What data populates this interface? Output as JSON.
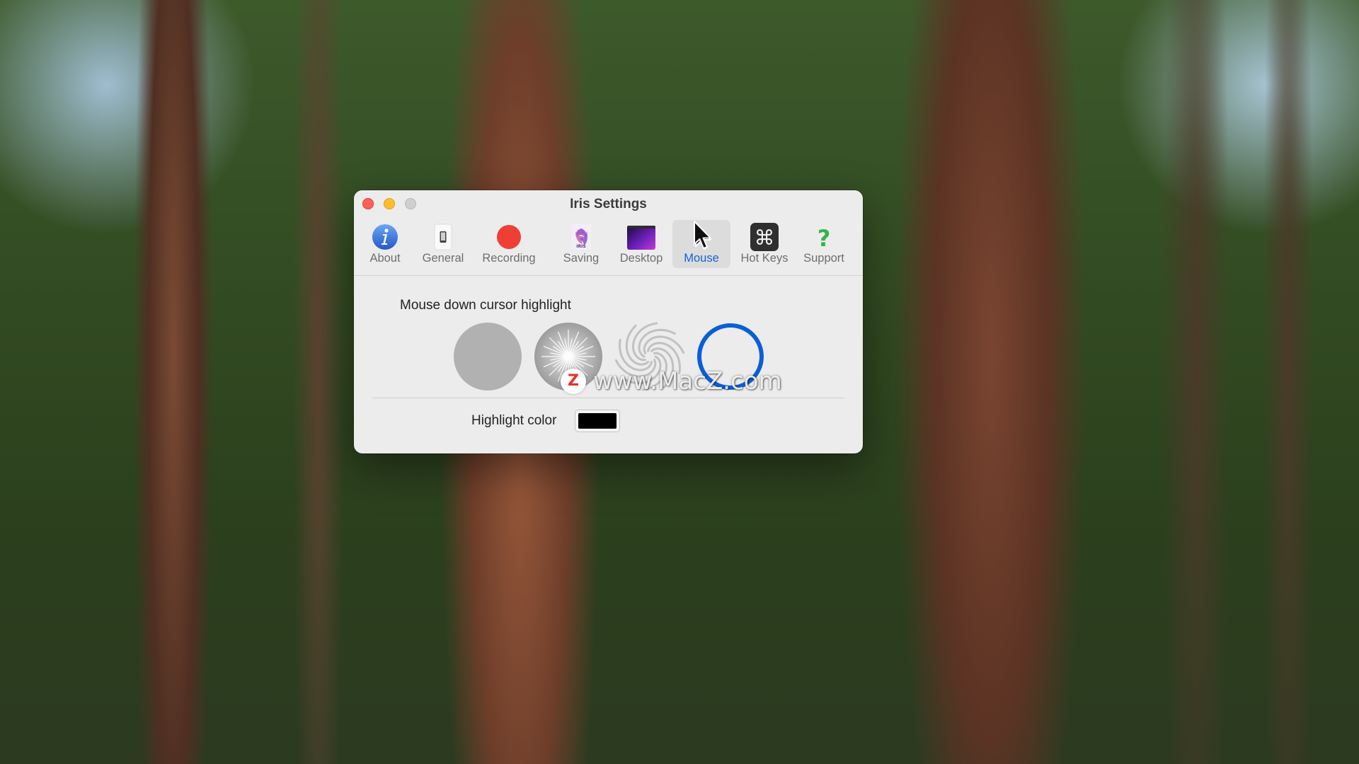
{
  "window": {
    "title": "Iris Settings"
  },
  "toolbar": {
    "tabs": [
      {
        "label": "About",
        "icon": "info-icon"
      },
      {
        "label": "General",
        "icon": "phone-icon"
      },
      {
        "label": "Recording",
        "icon": "record-icon"
      },
      {
        "label": "Saving",
        "icon": "iris-app-icon"
      },
      {
        "label": "Desktop",
        "icon": "desktop-wallpaper-icon"
      },
      {
        "label": "Mouse",
        "icon": "mouse-pointer-icon",
        "selected": true
      },
      {
        "label": "Hot Keys",
        "icon": "command-key-icon"
      },
      {
        "label": "Support",
        "icon": "question-icon"
      }
    ]
  },
  "mouse": {
    "section_title": "Mouse down cursor highlight",
    "styles": [
      {
        "name": "solid-circle",
        "color": "#b1b1b1"
      },
      {
        "name": "starburst",
        "color": "#a9a9a9"
      },
      {
        "name": "swirl",
        "color": "#bdbdbd"
      },
      {
        "name": "ring",
        "color": "#0b5fd6",
        "selected": true
      }
    ],
    "highlight_color_label": "Highlight color",
    "highlight_color_value": "#000000"
  },
  "colors": {
    "accent": "#1463d6",
    "close": "#ff5f57",
    "minimize": "#febc2e",
    "zoom_disabled": "#cfcfcf"
  },
  "watermark": {
    "badge": "Z",
    "text": "www.MacZ.com"
  }
}
